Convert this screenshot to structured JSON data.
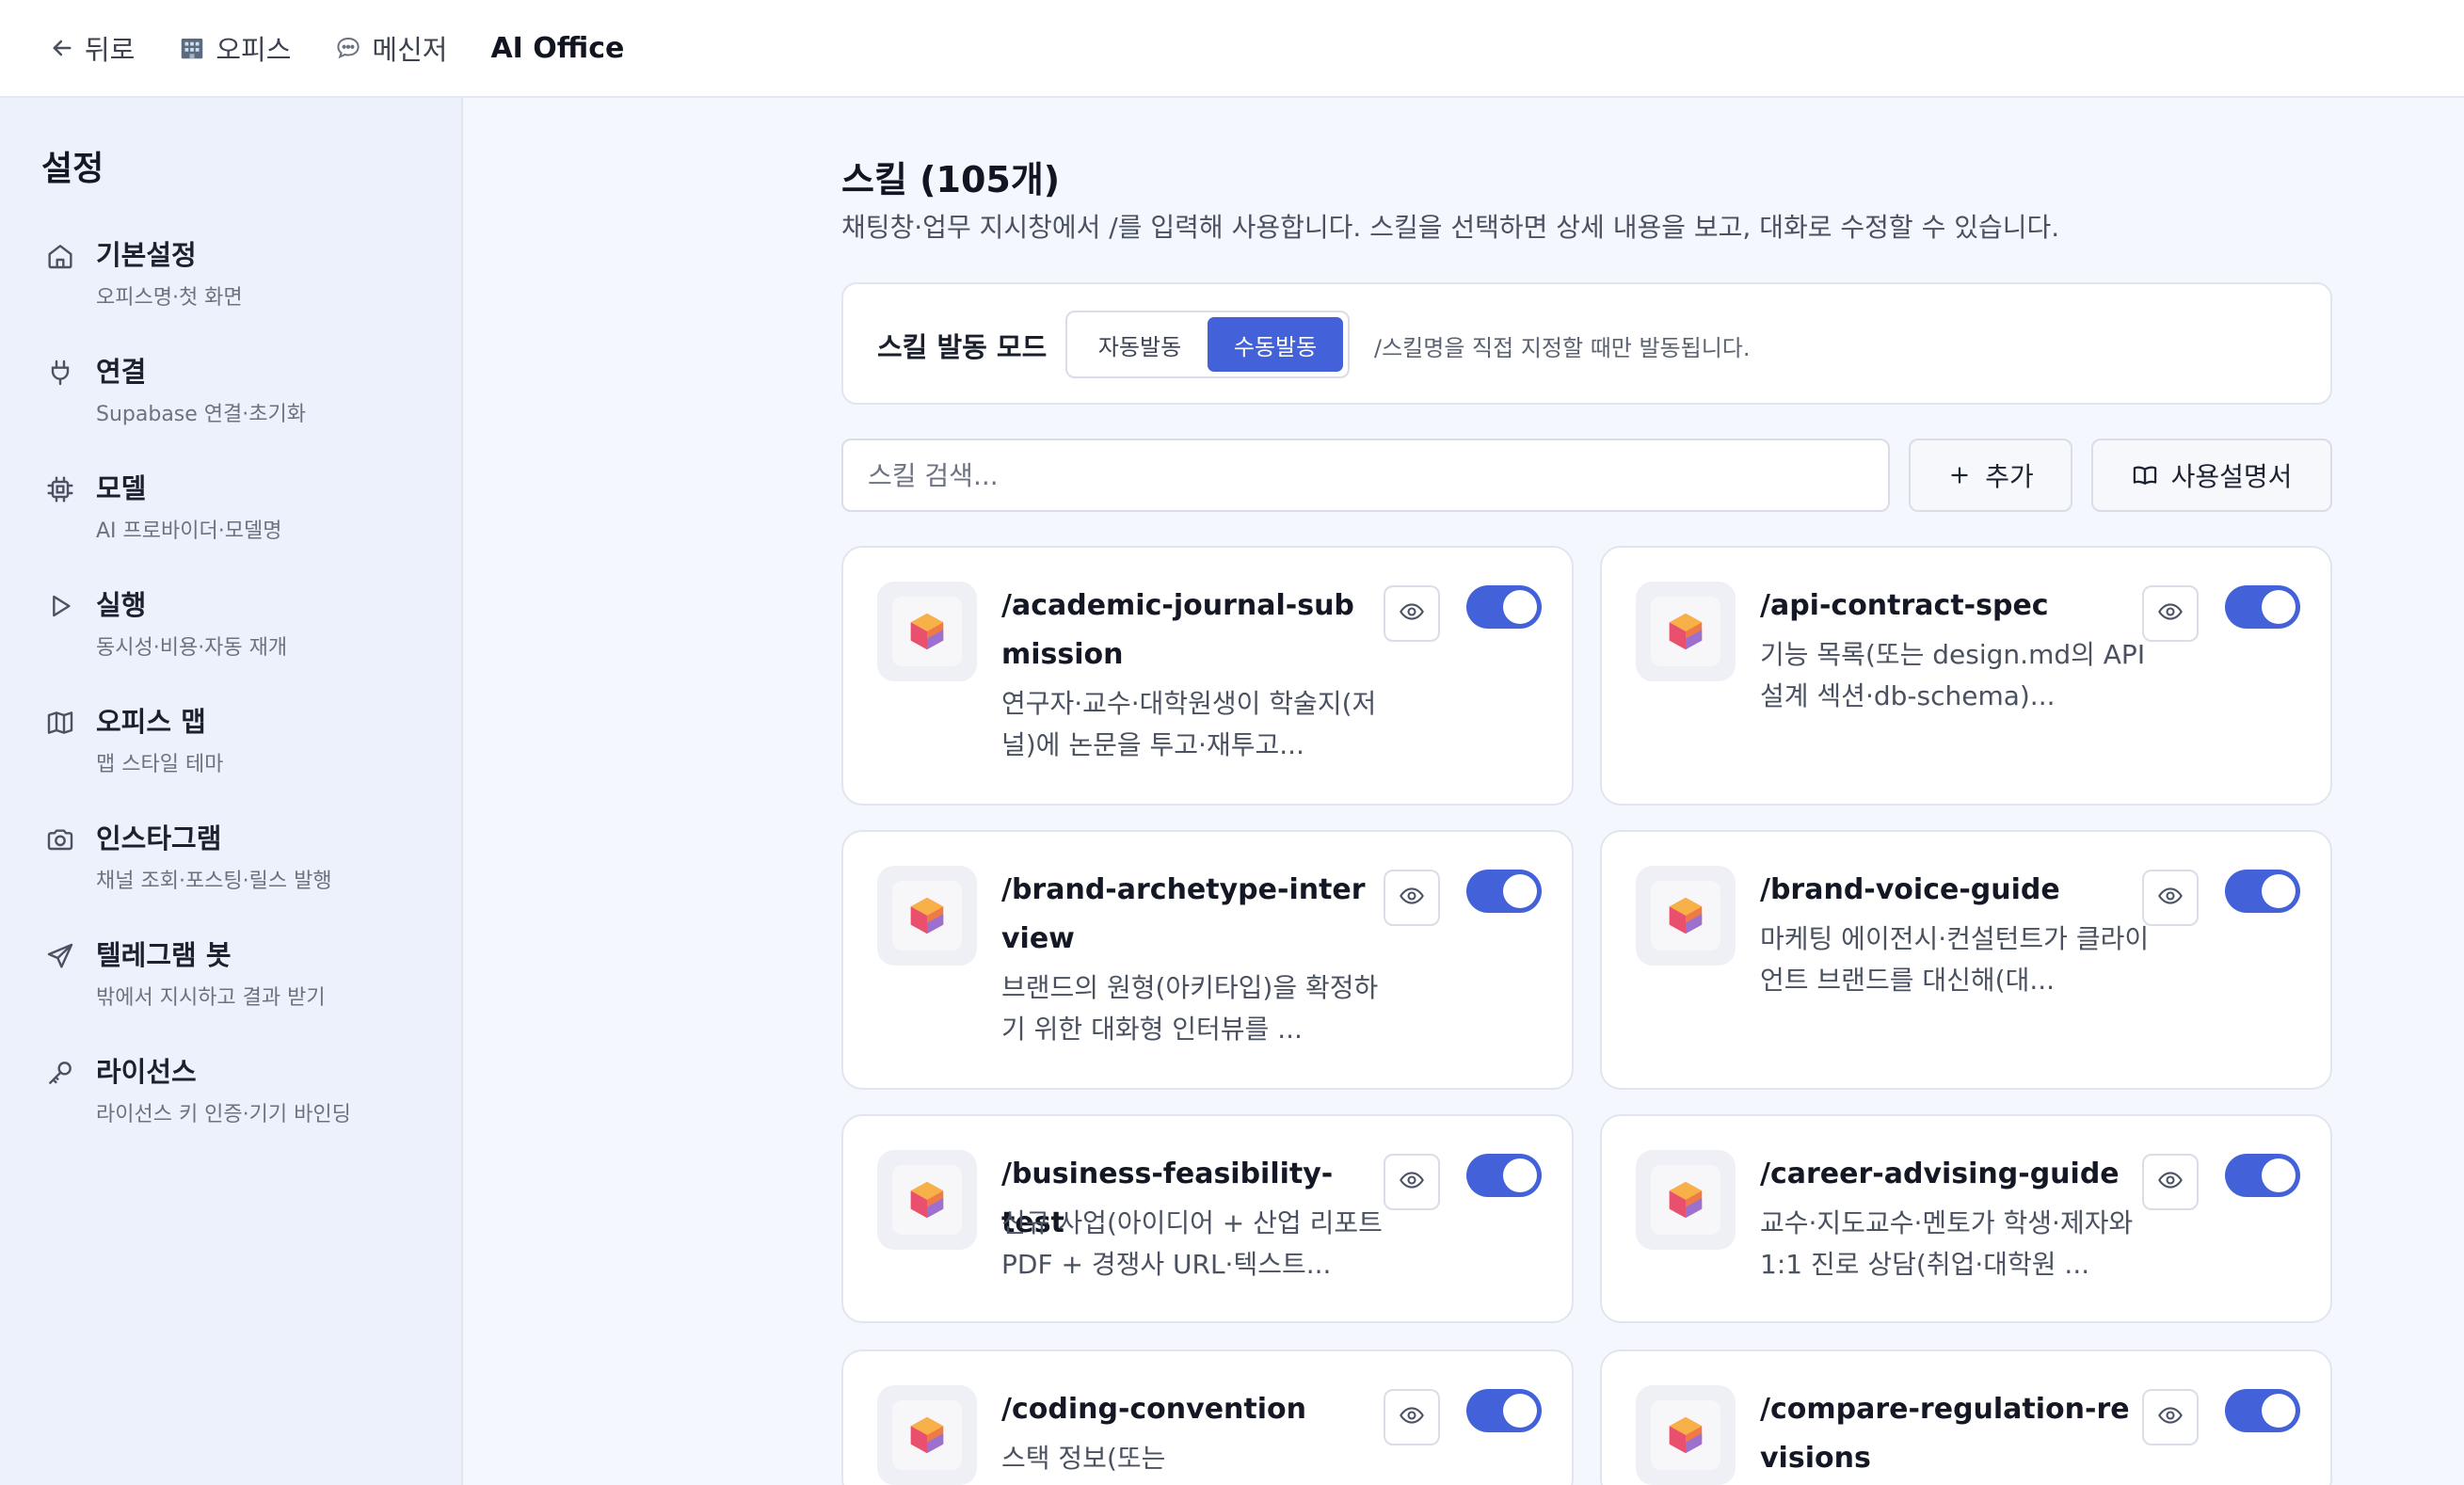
{
  "topbar": {
    "back": "뒤로",
    "office": "오피스",
    "messenger": "메신저",
    "brand": "AI Office"
  },
  "sidebar": {
    "title": "설정",
    "items": [
      {
        "label": "기본설정",
        "sub": "오피스명·첫 화면",
        "icon": "home-icon"
      },
      {
        "label": "연결",
        "sub": "Supabase 연결·초기화",
        "icon": "plug-icon"
      },
      {
        "label": "모델",
        "sub": "AI 프로바이더·모델명",
        "icon": "chip-icon"
      },
      {
        "label": "실행",
        "sub": "동시성·비용·자동 재개",
        "icon": "play-icon"
      },
      {
        "label": "오피스 맵",
        "sub": "맵 스타일 테마",
        "icon": "map-icon"
      },
      {
        "label": "인스타그램",
        "sub": "채널 조회·포스팅·릴스 발행",
        "icon": "camera-icon"
      },
      {
        "label": "텔레그램 봇",
        "sub": "밖에서 지시하고 결과 받기",
        "icon": "send-icon"
      },
      {
        "label": "라이선스",
        "sub": "라이선스 키 인증·기기 바인딩",
        "icon": "key-icon"
      }
    ]
  },
  "main": {
    "title": "스킬 (105개)",
    "description": "채팅창·업무 지시창에서 /를 입력해 사용합니다. 스킬을 선택하면 상세 내용을 보고, 대화로 수정할 수 있습니다.",
    "mode": {
      "label": "스킬 발동 모드",
      "options": [
        "자동발동",
        "수동발동"
      ],
      "selected": "수동발동",
      "hint": "/스킬명을 직접 지정할 때만 발동됩니다."
    },
    "search_placeholder": "스킬 검색...",
    "add_label": "추가",
    "manual_label": "사용설명서",
    "accent": "#4361d8",
    "skills": [
      {
        "name": "/academic-journal-submission",
        "desc": "연구자·교수·대학원생이 학술지(저널)에 논문을 투고·재투고...",
        "enabled": true
      },
      {
        "name": "/api-contract-spec",
        "desc": "기능 목록(또는 design.md의 API 설계 섹션·db-schema)...",
        "enabled": true
      },
      {
        "name": "/brand-archetype-interview",
        "desc": "브랜드의 원형(아키타입)을 확정하기 위한 대화형 인터뷰를 ...",
        "enabled": true
      },
      {
        "name": "/brand-voice-guide",
        "desc": "마케팅 에이전시·컨설턴트가 클라이언트 브랜드를 대신해(대...",
        "enabled": true
      },
      {
        "name": "/business-feasibility-test",
        "desc": "신규 사업(아이디어 + 산업 리포트 PDF + 경쟁사 URL·텍스트...",
        "enabled": true
      },
      {
        "name": "/career-advising-guide",
        "desc": "교수·지도교수·멘토가 학생·제자와 1:1 진로 상담(취업·대학원 ...",
        "enabled": true
      },
      {
        "name": "/coding-convention",
        "desc": "스택 정보(또는",
        "enabled": true
      },
      {
        "name": "/compare-regulation-revisions",
        "desc": "",
        "enabled": true
      }
    ]
  }
}
